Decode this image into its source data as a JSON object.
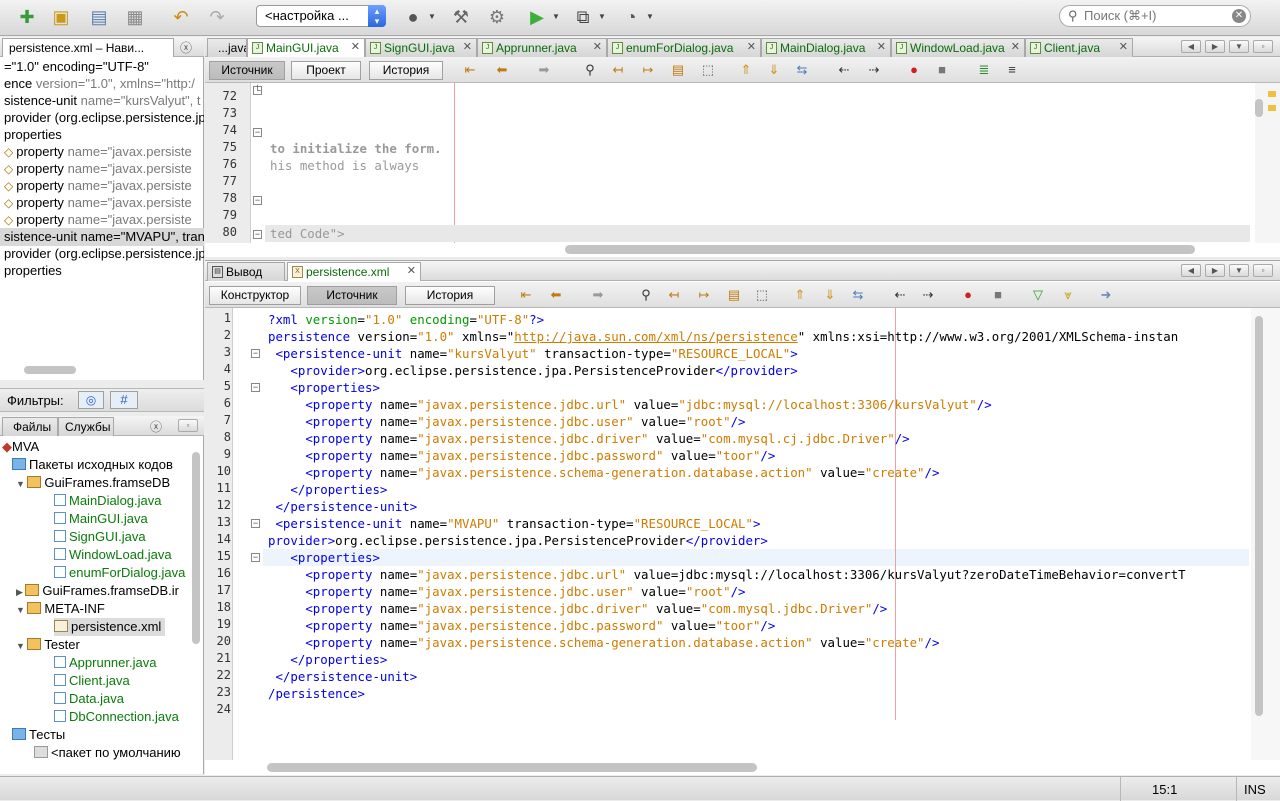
{
  "toolbar": {
    "config_value": "<настройка ...",
    "search_placeholder": "Поиск (⌘+I)"
  },
  "navigator": {
    "title": "persistence.xml – Нави...",
    "lines": [
      "=\"1.0\" encoding=\"UTF-8\"",
      "ence",
      "sistence-unit",
      "provider (org.eclipse.persistence.jp",
      "properties",
      "property",
      "property",
      "property",
      "property",
      "property",
      "sistence-unit name=\"MVAPU\", tran",
      "provider (org.eclipse.persistence.jp",
      "properties"
    ],
    "line_extras": {
      "ence": "version=\"1.0\", xmlns=\"http:/",
      "sistence-unit": "name=\"kursValyut\", t",
      "property": "name=\"javax.persiste"
    },
    "filters_label": "Фильтры:"
  },
  "files_panel": {
    "tabs": [
      "Файлы",
      "Службы"
    ],
    "tree": [
      "MVA",
      "Пакеты исходных кодов",
      "GuiFrames.framseDB",
      "MainDialog.java",
      "MainGUI.java",
      "SignGUI.java",
      "WindowLoad.java",
      "enumForDialog.java",
      "GuiFrames.framseDB.ir",
      "META-INF",
      "persistence.xml",
      "Tester",
      "Apprunner.java",
      "Client.java",
      "Data.java",
      "DbConnection.java",
      "Тесты",
      "<пакет по умолчанию"
    ]
  },
  "editor_top": {
    "tabs": [
      "...java",
      "MainGUI.java",
      "SignGUI.java",
      "Apprunner.java",
      "enumForDialog.java",
      "MainDialog.java",
      "WindowLoad.java",
      "Client.java"
    ],
    "modes": [
      "Источник",
      "Проект",
      "История"
    ],
    "line_numbers": [
      "72",
      "73",
      "74",
      "75",
      "76",
      "77",
      "78",
      "79",
      "80"
    ],
    "code": [
      "",
      "",
      "",
      "to initialize the form.",
      "his method is always",
      "",
      "",
      "",
      "ted Code\">"
    ]
  },
  "editor_bottom": {
    "tabs": [
      "Вывод",
      "persistence.xml"
    ],
    "modes": [
      "Конструктор",
      "Источник",
      "История"
    ],
    "line_numbers": [
      "1",
      "2",
      "3",
      "4",
      "5",
      "6",
      "7",
      "8",
      "9",
      "10",
      "11",
      "12",
      "13",
      "14",
      "15",
      "16",
      "17",
      "18",
      "19",
      "20",
      "21",
      "22",
      "23",
      "24"
    ],
    "code_lines": [
      "?xml version=\"1.0\" encoding=\"UTF-8\"?>",
      "persistence version=\"1.0\" xmlns=\"http://java.sun.com/xml/ns/persistence\" xmlns:xsi=\"http://www.w3.org/2001/XMLSchema-instan",
      " <persistence-unit name=\"kursValyut\" transaction-type=\"RESOURCE_LOCAL\">",
      "   <provider>org.eclipse.persistence.jpa.PersistenceProvider</provider>",
      "   <properties>",
      "     <property name=\"javax.persistence.jdbc.url\" value=\"jdbc:mysql://localhost:3306/kursValyut\"/>",
      "     <property name=\"javax.persistence.jdbc.user\" value=\"root\"/>",
      "     <property name=\"javax.persistence.jdbc.driver\" value=\"com.mysql.cj.jdbc.Driver\"/>",
      "     <property name=\"javax.persistence.jdbc.password\" value=\"toor\"/>",
      "     <property name=\"javax.persistence.schema-generation.database.action\" value=\"create\"/>",
      "   </properties>",
      " </persistence-unit>",
      " <persistence-unit name=\"MVAPU\" transaction-type=\"RESOURCE_LOCAL\">",
      "provider>org.eclipse.persistence.jpa.PersistenceProvider</provider>",
      "   <properties>",
      "     <property name=\"javax.persistence.jdbc.url\" value=\"jdbc:mysql://localhost:3306/kursValyut?zeroDateTimeBehavior=convertT",
      "     <property name=\"javax.persistence.jdbc.user\" value=\"root\"/>",
      "     <property name=\"javax.persistence.jdbc.driver\" value=\"com.mysql.jdbc.Driver\"/>",
      "     <property name=\"javax.persistence.jdbc.password\" value=\"toor\"/>",
      "     <property name=\"javax.persistence.schema-generation.database.action\" value=\"create\"/>",
      "   </properties>",
      " </persistence-unit>",
      "/persistence>",
      ""
    ]
  },
  "status": {
    "position": "15:1",
    "mode": "INS"
  }
}
